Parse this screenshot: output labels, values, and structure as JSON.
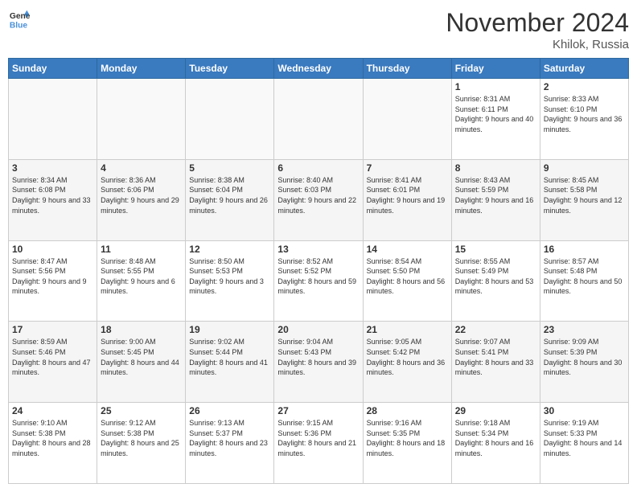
{
  "logo": {
    "line1": "General",
    "line2": "Blue"
  },
  "title": "November 2024",
  "location": "Khilok, Russia",
  "days_of_week": [
    "Sunday",
    "Monday",
    "Tuesday",
    "Wednesday",
    "Thursday",
    "Friday",
    "Saturday"
  ],
  "weeks": [
    [
      {
        "day": "",
        "info": ""
      },
      {
        "day": "",
        "info": ""
      },
      {
        "day": "",
        "info": ""
      },
      {
        "day": "",
        "info": ""
      },
      {
        "day": "",
        "info": ""
      },
      {
        "day": "1",
        "info": "Sunrise: 8:31 AM\nSunset: 6:11 PM\nDaylight: 9 hours and 40 minutes."
      },
      {
        "day": "2",
        "info": "Sunrise: 8:33 AM\nSunset: 6:10 PM\nDaylight: 9 hours and 36 minutes."
      }
    ],
    [
      {
        "day": "3",
        "info": "Sunrise: 8:34 AM\nSunset: 6:08 PM\nDaylight: 9 hours and 33 minutes."
      },
      {
        "day": "4",
        "info": "Sunrise: 8:36 AM\nSunset: 6:06 PM\nDaylight: 9 hours and 29 minutes."
      },
      {
        "day": "5",
        "info": "Sunrise: 8:38 AM\nSunset: 6:04 PM\nDaylight: 9 hours and 26 minutes."
      },
      {
        "day": "6",
        "info": "Sunrise: 8:40 AM\nSunset: 6:03 PM\nDaylight: 9 hours and 22 minutes."
      },
      {
        "day": "7",
        "info": "Sunrise: 8:41 AM\nSunset: 6:01 PM\nDaylight: 9 hours and 19 minutes."
      },
      {
        "day": "8",
        "info": "Sunrise: 8:43 AM\nSunset: 5:59 PM\nDaylight: 9 hours and 16 minutes."
      },
      {
        "day": "9",
        "info": "Sunrise: 8:45 AM\nSunset: 5:58 PM\nDaylight: 9 hours and 12 minutes."
      }
    ],
    [
      {
        "day": "10",
        "info": "Sunrise: 8:47 AM\nSunset: 5:56 PM\nDaylight: 9 hours and 9 minutes."
      },
      {
        "day": "11",
        "info": "Sunrise: 8:48 AM\nSunset: 5:55 PM\nDaylight: 9 hours and 6 minutes."
      },
      {
        "day": "12",
        "info": "Sunrise: 8:50 AM\nSunset: 5:53 PM\nDaylight: 9 hours and 3 minutes."
      },
      {
        "day": "13",
        "info": "Sunrise: 8:52 AM\nSunset: 5:52 PM\nDaylight: 8 hours and 59 minutes."
      },
      {
        "day": "14",
        "info": "Sunrise: 8:54 AM\nSunset: 5:50 PM\nDaylight: 8 hours and 56 minutes."
      },
      {
        "day": "15",
        "info": "Sunrise: 8:55 AM\nSunset: 5:49 PM\nDaylight: 8 hours and 53 minutes."
      },
      {
        "day": "16",
        "info": "Sunrise: 8:57 AM\nSunset: 5:48 PM\nDaylight: 8 hours and 50 minutes."
      }
    ],
    [
      {
        "day": "17",
        "info": "Sunrise: 8:59 AM\nSunset: 5:46 PM\nDaylight: 8 hours and 47 minutes."
      },
      {
        "day": "18",
        "info": "Sunrise: 9:00 AM\nSunset: 5:45 PM\nDaylight: 8 hours and 44 minutes."
      },
      {
        "day": "19",
        "info": "Sunrise: 9:02 AM\nSunset: 5:44 PM\nDaylight: 8 hours and 41 minutes."
      },
      {
        "day": "20",
        "info": "Sunrise: 9:04 AM\nSunset: 5:43 PM\nDaylight: 8 hours and 39 minutes."
      },
      {
        "day": "21",
        "info": "Sunrise: 9:05 AM\nSunset: 5:42 PM\nDaylight: 8 hours and 36 minutes."
      },
      {
        "day": "22",
        "info": "Sunrise: 9:07 AM\nSunset: 5:41 PM\nDaylight: 8 hours and 33 minutes."
      },
      {
        "day": "23",
        "info": "Sunrise: 9:09 AM\nSunset: 5:39 PM\nDaylight: 8 hours and 30 minutes."
      }
    ],
    [
      {
        "day": "24",
        "info": "Sunrise: 9:10 AM\nSunset: 5:38 PM\nDaylight: 8 hours and 28 minutes."
      },
      {
        "day": "25",
        "info": "Sunrise: 9:12 AM\nSunset: 5:38 PM\nDaylight: 8 hours and 25 minutes."
      },
      {
        "day": "26",
        "info": "Sunrise: 9:13 AM\nSunset: 5:37 PM\nDaylight: 8 hours and 23 minutes."
      },
      {
        "day": "27",
        "info": "Sunrise: 9:15 AM\nSunset: 5:36 PM\nDaylight: 8 hours and 21 minutes."
      },
      {
        "day": "28",
        "info": "Sunrise: 9:16 AM\nSunset: 5:35 PM\nDaylight: 8 hours and 18 minutes."
      },
      {
        "day": "29",
        "info": "Sunrise: 9:18 AM\nSunset: 5:34 PM\nDaylight: 8 hours and 16 minutes."
      },
      {
        "day": "30",
        "info": "Sunrise: 9:19 AM\nSunset: 5:33 PM\nDaylight: 8 hours and 14 minutes."
      }
    ]
  ]
}
